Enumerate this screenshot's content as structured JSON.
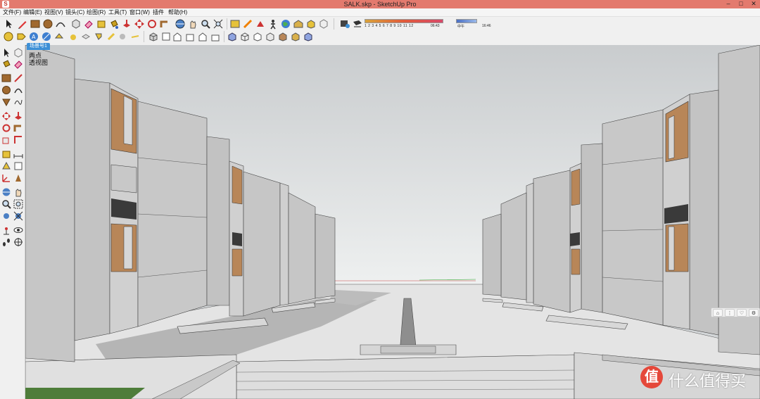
{
  "window": {
    "title": "SALK.skp - SketchUp Pro",
    "app_icon": "sketchup-logo-icon",
    "controls": [
      "minimize-icon",
      "maximize-icon",
      "close-icon"
    ]
  },
  "menu": [
    {
      "label": "文件(F)"
    },
    {
      "label": "编辑(E)"
    },
    {
      "label": "视图(V)"
    },
    {
      "label": "镜头(C)"
    },
    {
      "label": "绘图(R)"
    },
    {
      "label": "工具(T)"
    },
    {
      "label": "窗口(W)"
    },
    {
      "label": "插件"
    },
    {
      "label": "帮助(H)"
    }
  ],
  "shadow_settings": {
    "months": "1 2 3 4 5 6 7 8 9 10 11 12",
    "time_start": "06:43",
    "noon": "中午",
    "time_end": "16:46"
  },
  "toolbar_icons": [
    "select-icon",
    "eraser-icon",
    "pencil-icon",
    "rectangle-icon",
    "circle-icon",
    "paint-bucket-icon",
    "push-pull-icon",
    "move-icon",
    "rotate-icon",
    "follow-me-icon",
    "scale-icon",
    "offset-icon",
    "orbit-icon",
    "pan-icon",
    "zoom-icon",
    "zoom-extents-icon",
    "shadow-settings-icon"
  ],
  "scene": {
    "tab_label": "场景号1",
    "view_lines": [
      "两点",
      "透视图"
    ]
  },
  "float_panel": [
    "camera-icon",
    "more-icon",
    "heart-icon",
    "gear-icon"
  ],
  "watermark": {
    "badge": "值",
    "text": "什么值得买"
  },
  "colors": {
    "titlebar": "#e37a6e",
    "scene_tab": "#3c8fd6",
    "sky": "#d3d6d8",
    "wall": "#c8c8c8",
    "window_wood": "#b88658",
    "grass": "#4e7d3a"
  }
}
